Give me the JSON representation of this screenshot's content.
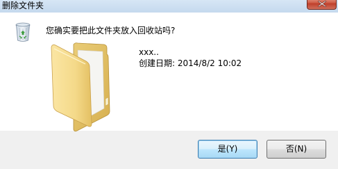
{
  "window": {
    "title": "删除文件夹"
  },
  "dialog": {
    "question": "您确实要把此文件夹放入回收站吗?",
    "file_name": "xxx..",
    "created_label": "创建日期:",
    "created_value": "2014/8/2 10:02"
  },
  "buttons": {
    "yes_label": "是(Y)",
    "no_label": "否(N)"
  },
  "icons": {
    "title_close": "close-icon",
    "dialog_icon": "recycle-bin-icon",
    "item_icon": "folder-icon"
  }
}
